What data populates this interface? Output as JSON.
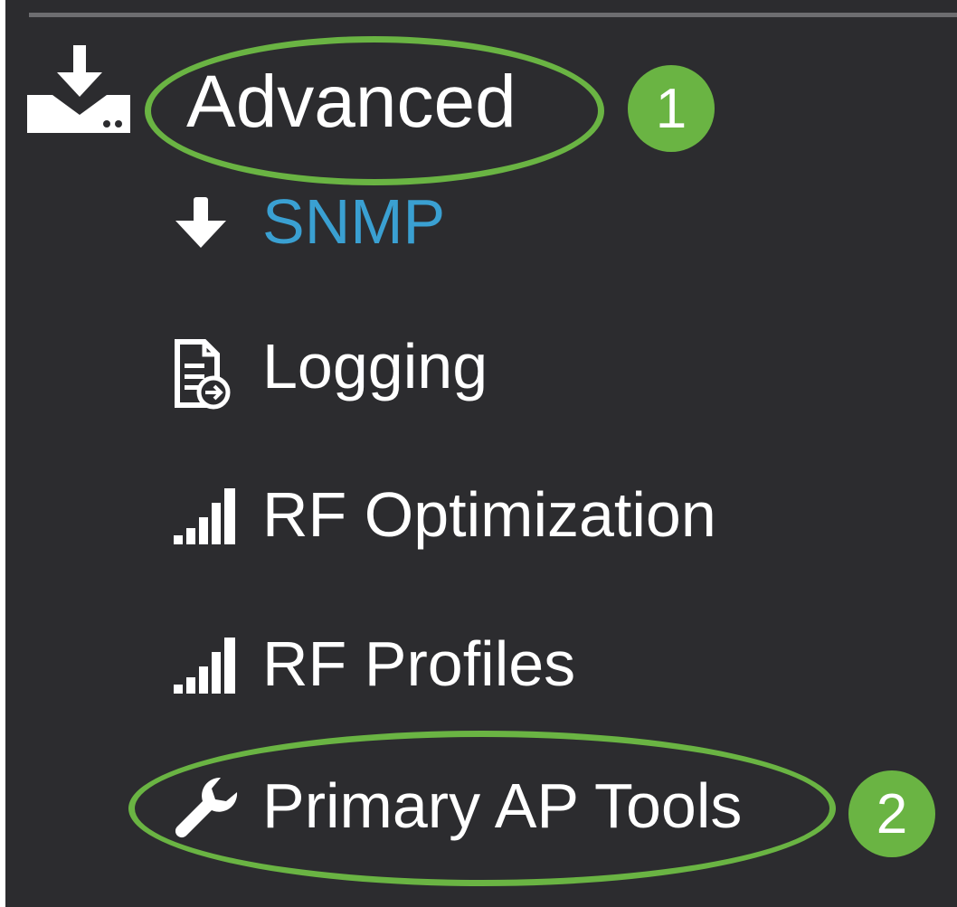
{
  "section": {
    "icon": "download-tray-icon",
    "label": "Advanced"
  },
  "menu": {
    "items": [
      {
        "label": "SNMP",
        "icon": "arrow-down-icon",
        "color": "#3aa0d2"
      },
      {
        "label": "Logging",
        "icon": "log-file-icon"
      },
      {
        "label": "RF Optimization",
        "icon": "signal-bars-icon"
      },
      {
        "label": "RF Profiles",
        "icon": "signal-bars-icon"
      },
      {
        "label": "Primary AP Tools",
        "icon": "wrench-icon"
      }
    ]
  },
  "annotations": {
    "step_1": "1",
    "step_2": "2",
    "highlight_color": "#6ab443"
  },
  "colors": {
    "background": "#2c2c2f",
    "text": "#ffffff",
    "active_link": "#3aa0d2"
  }
}
